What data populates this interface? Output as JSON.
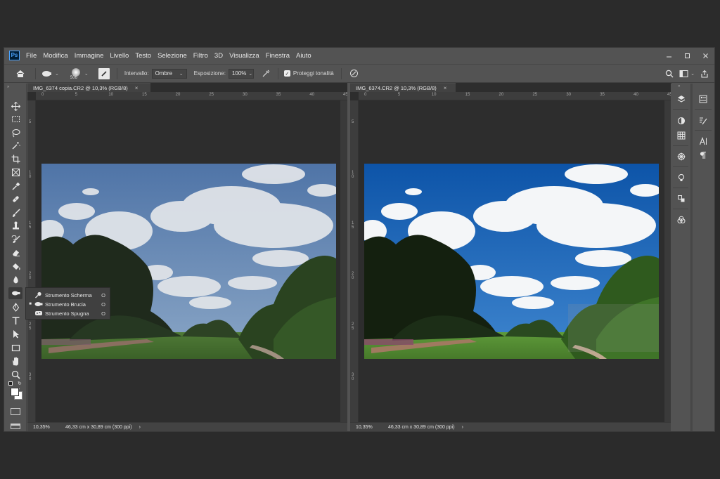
{
  "app": {
    "logo": "Ps",
    "menu": [
      "File",
      "Modifica",
      "Immagine",
      "Livello",
      "Testo",
      "Selezione",
      "Filtro",
      "3D",
      "Visualizza",
      "Finestra",
      "Aiuto"
    ],
    "window_controls": [
      "minimize",
      "maximize",
      "close"
    ]
  },
  "options": {
    "brush_size": "506",
    "range_label": "Intervallo:",
    "range_value": "Ombre",
    "exposure_label": "Esposizione:",
    "exposure_value": "100%",
    "protect_tones_label": "Proteggi tonalità",
    "protect_tones_checked": true
  },
  "tools": [
    {
      "name": "move-tool-icon"
    },
    {
      "name": "marquee-tool-icon"
    },
    {
      "name": "lasso-tool-icon"
    },
    {
      "name": "magic-wand-tool-icon"
    },
    {
      "name": "crop-tool-icon"
    },
    {
      "name": "frame-tool-icon"
    },
    {
      "name": "eyedropper-tool-icon"
    },
    {
      "name": "healing-brush-tool-icon"
    },
    {
      "name": "brush-tool-icon"
    },
    {
      "name": "clone-stamp-tool-icon"
    },
    {
      "name": "history-brush-tool-icon"
    },
    {
      "name": "eraser-tool-icon"
    },
    {
      "name": "paint-bucket-tool-icon"
    },
    {
      "name": "blur-tool-icon"
    },
    {
      "name": "dodge-tool-icon"
    },
    {
      "name": "pen-tool-icon"
    },
    {
      "name": "type-tool-icon"
    },
    {
      "name": "path-selection-tool-icon"
    },
    {
      "name": "rectangle-tool-icon"
    },
    {
      "name": "hand-tool-icon"
    },
    {
      "name": "zoom-tool-icon"
    },
    {
      "name": "more-tools-icon"
    }
  ],
  "flyout": [
    {
      "label": "Strumento Scherma",
      "key": "O",
      "selected": false
    },
    {
      "label": "Strumento Brucia",
      "key": "O",
      "selected": true
    },
    {
      "label": "Strumento Spugna",
      "key": "O",
      "selected": false
    }
  ],
  "documents": [
    {
      "tab_title": "IMG_6374 copia.CR2 @ 10,3% (RGB/8)",
      "zoom": "10,35%",
      "doc_size": "46,33 cm x 30,89 cm (300 ppi)"
    },
    {
      "tab_title": "IMG_6374.CR2 @ 10,3% (RGB/8)",
      "zoom": "10,35%",
      "doc_size": "46,33 cm x 30,89 cm (300 ppi)"
    }
  ],
  "ruler_ticks": [
    "0",
    "5",
    "10",
    "15",
    "20",
    "25",
    "30",
    "35",
    "40",
    "45"
  ],
  "ruler_v_ticks": [
    "5",
    "1 0",
    "1 5",
    "2 0",
    "2 5",
    "3 0"
  ],
  "colors": {
    "app_bg": "#535353",
    "canvas_bg": "#2d2d2d",
    "accent": "#4aa3ff"
  }
}
